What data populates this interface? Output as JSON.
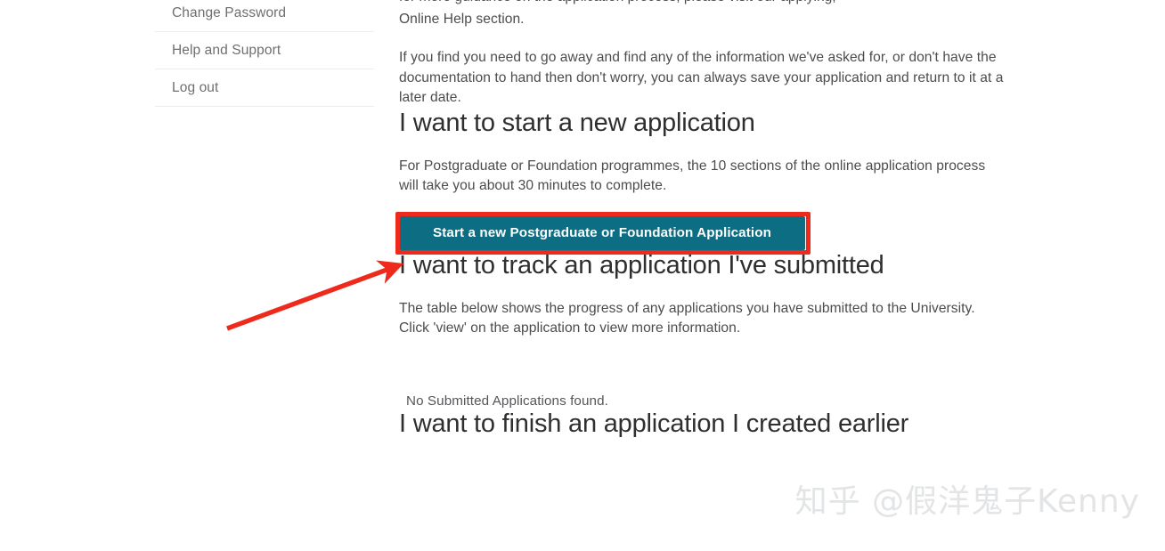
{
  "account_nav": {
    "items": [
      {
        "label": "Change Password",
        "name": "sidebar-item-change-password"
      },
      {
        "label": "Help and Support",
        "name": "sidebar-item-help-and-support"
      },
      {
        "label": "Log out",
        "name": "sidebar-item-log-out"
      }
    ]
  },
  "content": {
    "intro_clipped_line": "for more guidance on the application process, please visit our applying,",
    "intro_line_2": "Online Help section.",
    "save_and_return_paragraph": "If you find you need to go away and find any of the information we've asked for, or don't have the documentation to hand then don't worry, you can always save your application and return to it at a later date.",
    "start_heading": "I want to start a new application",
    "start_paragraph": "For Postgraduate or Foundation programmes, the 10 sections of the online application process will take you about 30 minutes to complete.",
    "start_button_label": "Start a new Postgraduate or Foundation Application",
    "track_heading": "I want to track an application I've submitted",
    "track_paragraph": "The table below shows the progress of any applications you have submitted to the University. Click 'view' on the application to view more information.",
    "no_submitted_applications": "No Submitted Applications found.",
    "finish_heading": "I want to finish an application I created earlier"
  },
  "annotations": {
    "arrow_name": "red-annotation-arrow",
    "highlight_name": "red-annotation-highlight-box",
    "color": "#ee2a1d"
  },
  "watermark": {
    "text": "知乎 @假洋鬼子Kenny"
  },
  "colors": {
    "button_teal": "#0d6d82",
    "annotation_red": "#ee2a1d",
    "heading": "#2e2f30",
    "body_text": "#4b4c4d",
    "nav_text": "#6e6f70",
    "divider": "#eceded",
    "watermark": "#e2e4e6"
  }
}
